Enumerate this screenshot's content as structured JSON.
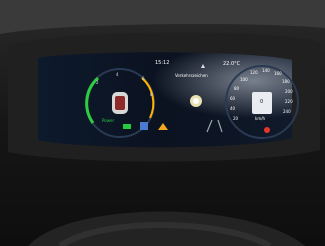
{
  "status_bar": {
    "time": "15:12",
    "outside_temp": "22.0°C",
    "mode_icon": "road-warning-icon"
  },
  "center_message": "Verkehrszeichen",
  "speedometer": {
    "tick_labels": [
      "20",
      "40",
      "60",
      "80",
      "100",
      "120",
      "140",
      "160",
      "180",
      "200",
      "220",
      "240"
    ],
    "units": "km/h",
    "center_value": "0"
  },
  "left_gauge": {
    "tick_labels": [
      "4",
      "6",
      "8",
      "2"
    ],
    "label": "Power",
    "color_charge": "#2ecc40",
    "color_accent": "#ffb400"
  },
  "indicators": {
    "green": "#27c93f",
    "amber": "#f5a623",
    "red": "#e6352b"
  },
  "bottom_icons": [
    "battery-icon",
    "lane-assist-icon",
    "warning-icon",
    "seatbelt-icon"
  ]
}
